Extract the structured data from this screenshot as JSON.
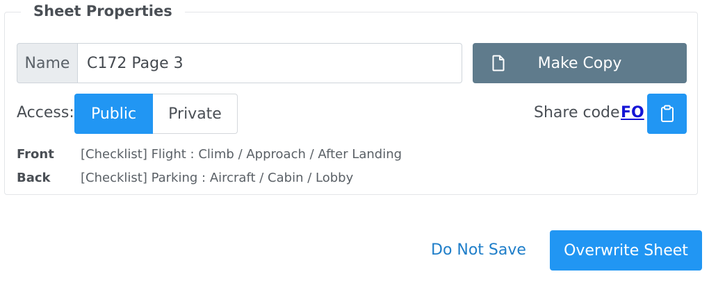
{
  "sheet_properties": {
    "legend": "Sheet Properties",
    "name": {
      "label": "Name",
      "value": "C172 Page 3"
    },
    "make_copy_label": "Make Copy",
    "access": {
      "label": "Access:",
      "options": [
        "Public",
        "Private"
      ],
      "selected": "Public"
    },
    "share": {
      "label": "Share code",
      "code": "FO"
    },
    "front": {
      "label": "Front",
      "value": "[Checklist] Flight : Climb / Approach / After Landing"
    },
    "back": {
      "label": "Back",
      "value": "[Checklist] Parking : Aircraft / Cabin / Lobby"
    }
  },
  "actions": {
    "do_not_save_label": "Do Not Save",
    "overwrite_label": "Overwrite Sheet"
  },
  "icons": {
    "make_copy": "file-icon",
    "share": "clipboard-icon"
  },
  "colors": {
    "primary": "#2196f3",
    "secondary": "#5f7b8c",
    "link": "#1f7ec9",
    "share_code": "#1515d6"
  }
}
